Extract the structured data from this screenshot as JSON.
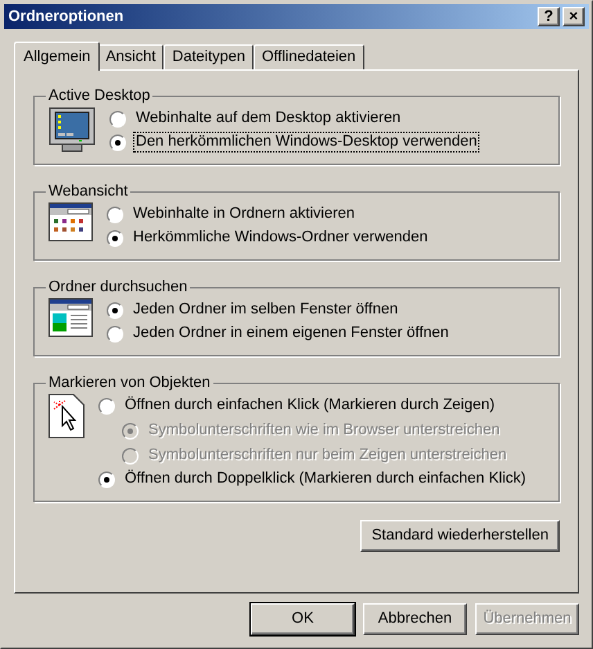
{
  "window": {
    "title": "Ordneroptionen",
    "buttons": [
      "?",
      "×"
    ]
  },
  "tabs": [
    {
      "label": "Allgemein",
      "selected": true
    },
    {
      "label": "Ansicht",
      "selected": false
    },
    {
      "label": "Dateitypen",
      "selected": false
    },
    {
      "label": "Offlinedateien",
      "selected": false
    }
  ],
  "groups": [
    {
      "title": "Active Desktop",
      "kind": "monitor",
      "options": [
        {
          "label": "Webinhalte auf dem Desktop aktivieren",
          "selected": false,
          "disabled": false,
          "focused": false
        },
        {
          "label": "Den herkömmlichen Windows-Desktop verwenden",
          "selected": true,
          "disabled": false,
          "focused": true
        }
      ]
    },
    {
      "title": "Webansicht",
      "kind": "web-window",
      "options": [
        {
          "label": "Webinhalte in Ordnern aktivieren",
          "selected": false,
          "disabled": false,
          "focused": false
        },
        {
          "label": "Herkömmliche Windows-Ordner verwenden",
          "selected": true,
          "disabled": false,
          "focused": false
        }
      ]
    },
    {
      "title": "Ordner durchsuchen",
      "kind": "browse-window",
      "options": [
        {
          "label": "Jeden Ordner im selben Fenster öffnen",
          "selected": true,
          "disabled": false,
          "focused": false
        },
        {
          "label": "Jeden Ordner in einem eigenen Fenster öffnen",
          "selected": false,
          "disabled": false,
          "focused": false
        }
      ]
    },
    {
      "title": "Markieren von Objekten",
      "kind": "cursor-page",
      "options": [
        {
          "label": "Öffnen durch einfachen Klick (Markieren durch Zeigen)",
          "selected": false,
          "disabled": false,
          "focused": false,
          "children": [
            {
              "label": "Symbolunterschriften wie im Browser unterstreichen",
              "selected": true,
              "disabled": true,
              "focused": false
            },
            {
              "label": "Symbolunterschriften nur beim Zeigen unterstreichen",
              "selected": false,
              "disabled": true,
              "focused": false
            }
          ]
        },
        {
          "label": "Öffnen durch Doppelklick (Markieren durch einfachen Klick)",
          "selected": true,
          "disabled": false,
          "focused": false
        }
      ]
    }
  ],
  "restore_button": {
    "label": "Standard wiederherstellen"
  },
  "buttons": [
    {
      "label": "OK",
      "default": true,
      "disabled": false
    },
    {
      "label": "Abbrechen",
      "default": false,
      "disabled": false
    },
    {
      "label": "Übernehmen",
      "default": false,
      "disabled": true
    }
  ]
}
